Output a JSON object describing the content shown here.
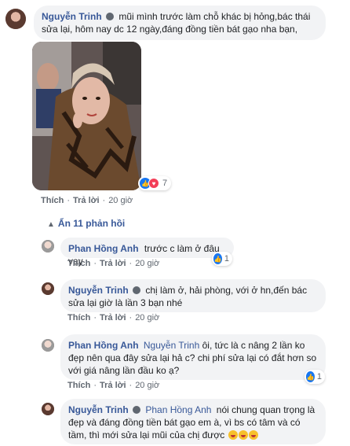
{
  "main_comment": {
    "author": "Nguyễn Trinh",
    "text": "mũi mình trước làm chỗ khác bị hỏng,bác thái sửa lại, hôm nay dc 12 ngày,đáng đồng tiền bát gạo nha bạn,",
    "like_label": "Thích",
    "reply_label": "Trả lời",
    "time": "20 giờ",
    "reaction_count": "7"
  },
  "hide_replies_label": "Ẩn 11 phản hồi",
  "replies": [
    {
      "author": "Phan Hồng Anh",
      "text": "trước c làm ở đâu vạy",
      "like_label": "Thích",
      "reply_label": "Trả lời",
      "time": "20 giờ",
      "reaction_count": "1"
    },
    {
      "author": "Nguyễn Trinh",
      "text": "chị làm ở, hải phòng, với ở hn,đến bác sửa lại giờ là lần 3 bạn nhé",
      "like_label": "Thích",
      "reply_label": "Trả lời",
      "time": "20 giờ"
    },
    {
      "author": "Phan Hồng Anh",
      "mention": "Nguyễn Trinh",
      "text": "ôi, tức là c nâng 2 lần ko đẹp nên qua đây sửa lại hả c? chi phí sửa lại có đắt hơn so với giá nâng lần đầu ko ạ?",
      "like_label": "Thích",
      "reply_label": "Trả lời",
      "time": "20 giờ",
      "reaction_count": "1"
    },
    {
      "author": "Nguyễn Trinh",
      "mention": "Phan Hồng Anh",
      "text": "nói chung quan trọng là đẹp và đáng đồng tiền bát gạo em à, vì bs có tâm và có tầm, thì mới sửa lại mũi của chị được"
    }
  ],
  "colors": {
    "link_blue": "#385898",
    "bubble_bg": "#f2f3f5",
    "like_blue": "#1877f2",
    "love_red": "#f33e58"
  }
}
